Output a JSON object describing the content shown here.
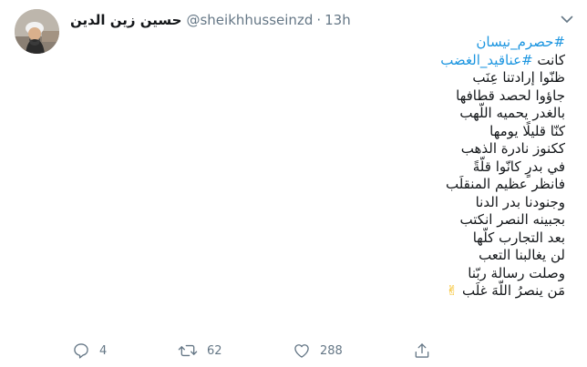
{
  "author": {
    "display_name": "حسين زين الدين",
    "handle": "@sheikhhusseinzd",
    "separator": "·",
    "time": "13h"
  },
  "tweet": {
    "lines": [
      [
        {
          "text": "#حصرم_نيسان",
          "hashtag": true
        }
      ],
      [
        {
          "text": "كانت ",
          "hashtag": false
        },
        {
          "text": "#عناقيد_الغضب",
          "hashtag": true
        }
      ],
      [
        {
          "text": "ظنّوا إرادتنا عِنَب",
          "hashtag": false
        }
      ],
      [
        {
          "text": "جاؤوا لحصد قطافها",
          "hashtag": false
        }
      ],
      [
        {
          "text": "بالغدر يحميه اللّهب",
          "hashtag": false
        }
      ],
      [
        {
          "text": "كنّا  قليلًا  يومها",
          "hashtag": false
        }
      ],
      [
        {
          "text": "ككنوز نادرة الذهب",
          "hashtag": false
        }
      ],
      [
        {
          "text": "في بدرٍ كانّوا قلّةً",
          "hashtag": false
        }
      ],
      [
        {
          "text": "فانظر عظيم المنقلَب",
          "hashtag": false
        }
      ],
      [
        {
          "text": "وجنودنا بدر الدنا",
          "hashtag": false
        }
      ],
      [
        {
          "text": "بجبينه النصر انكتب",
          "hashtag": false
        }
      ],
      [
        {
          "text": "بعد التجارب كلّها",
          "hashtag": false
        }
      ],
      [
        {
          "text": "لن يغالبنا التعب",
          "hashtag": false
        }
      ],
      [
        {
          "text": "وصلت رسالة ربّنا",
          "hashtag": false
        }
      ],
      [
        {
          "text": "مَن ينصرُ اللّهَ غلَب",
          "hashtag": false
        },
        {
          "text": " ✌",
          "hashtag": false,
          "emoji": true
        }
      ]
    ]
  },
  "actions": {
    "reply_count": "4",
    "retweet_count": "62",
    "like_count": "288"
  },
  "colors": {
    "link": "#1b95e0",
    "secondary": "#657786",
    "text": "#14171a"
  },
  "icons": [
    "avatar",
    "chevron-down-icon",
    "reply-icon",
    "retweet-icon",
    "like-icon",
    "share-icon"
  ]
}
